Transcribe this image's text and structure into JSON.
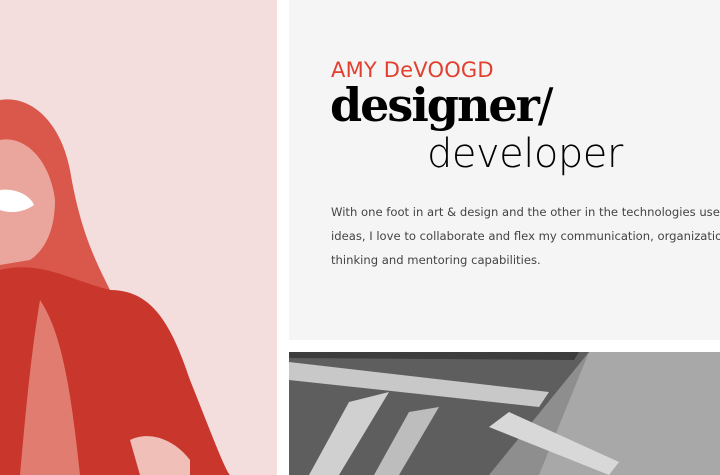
{
  "hero": {
    "name": "AMY DeVOOGD",
    "title_primary": "designer",
    "title_slash": "/",
    "title_secondary": "developer",
    "bio_lines": [
      "With one foot in art & design and the other in the technologies used",
      "ideas, I love to collaborate and flex my communication, organization",
      "thinking and mentoring capabilities."
    ]
  },
  "colors": {
    "accent": "#e2402f",
    "photo_tint": "#f4dedd",
    "panel": "#f5f5f5"
  }
}
